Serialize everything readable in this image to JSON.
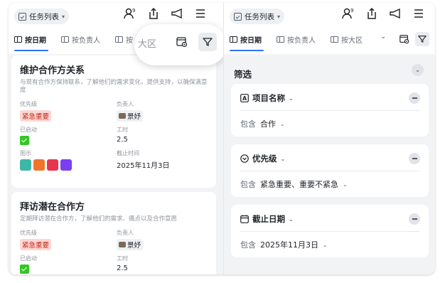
{
  "view_selector": {
    "label": "任务列表"
  },
  "tabs": [
    {
      "label": "按日期"
    },
    {
      "label": "按负责人"
    },
    {
      "label": "按大区"
    }
  ],
  "left_tab_partial": "按",
  "popover": {
    "text": "大区"
  },
  "cards": [
    {
      "title": "维护合作方关系",
      "desc": "与现有合作方保持联系，了解他们的需求变化，提供支持，以确保满意度",
      "priority_label": "优先级",
      "priority": "紧急重要",
      "owner_label": "负责人",
      "owner": "景妤",
      "started_label": "已启动",
      "hours_label": "工时",
      "hours": "2.5",
      "icon_label": "图示",
      "deadline_label": "截止时间",
      "deadline": "2025年11月3日"
    },
    {
      "title": "拜访潜在合作方",
      "desc": "定期拜访潜在合作方，了解他们的需求、痛点以及合作意愿",
      "priority_label": "优先级",
      "priority": "紧急重要",
      "owner_label": "负责人",
      "owner": "景妤",
      "started_label": "已启动",
      "hours_label": "工时",
      "hours": "2.5"
    }
  ],
  "filter": {
    "title": "筛选",
    "sections": [
      {
        "label": "项目名称",
        "op": "包含",
        "value": "合作"
      },
      {
        "label": "优先级",
        "op": "包含",
        "value": "紧急重要、重要不紧急"
      },
      {
        "label": "截止日期",
        "op": "包含",
        "value": "2025年11月3日"
      }
    ]
  },
  "colors": {
    "accent": "#3370ff",
    "tag_red_bg": "#fdd7d3",
    "tag_red_text": "#c72a1c",
    "check_green": "#34c724",
    "thumbs": [
      "#3db8a6",
      "#f0742c",
      "#e8344e",
      "#7b3ff2"
    ]
  },
  "icons": [
    "task-list-icon",
    "share-icon",
    "export-icon",
    "announce-icon",
    "menu-icon",
    "gear-icon",
    "filter-icon"
  ]
}
